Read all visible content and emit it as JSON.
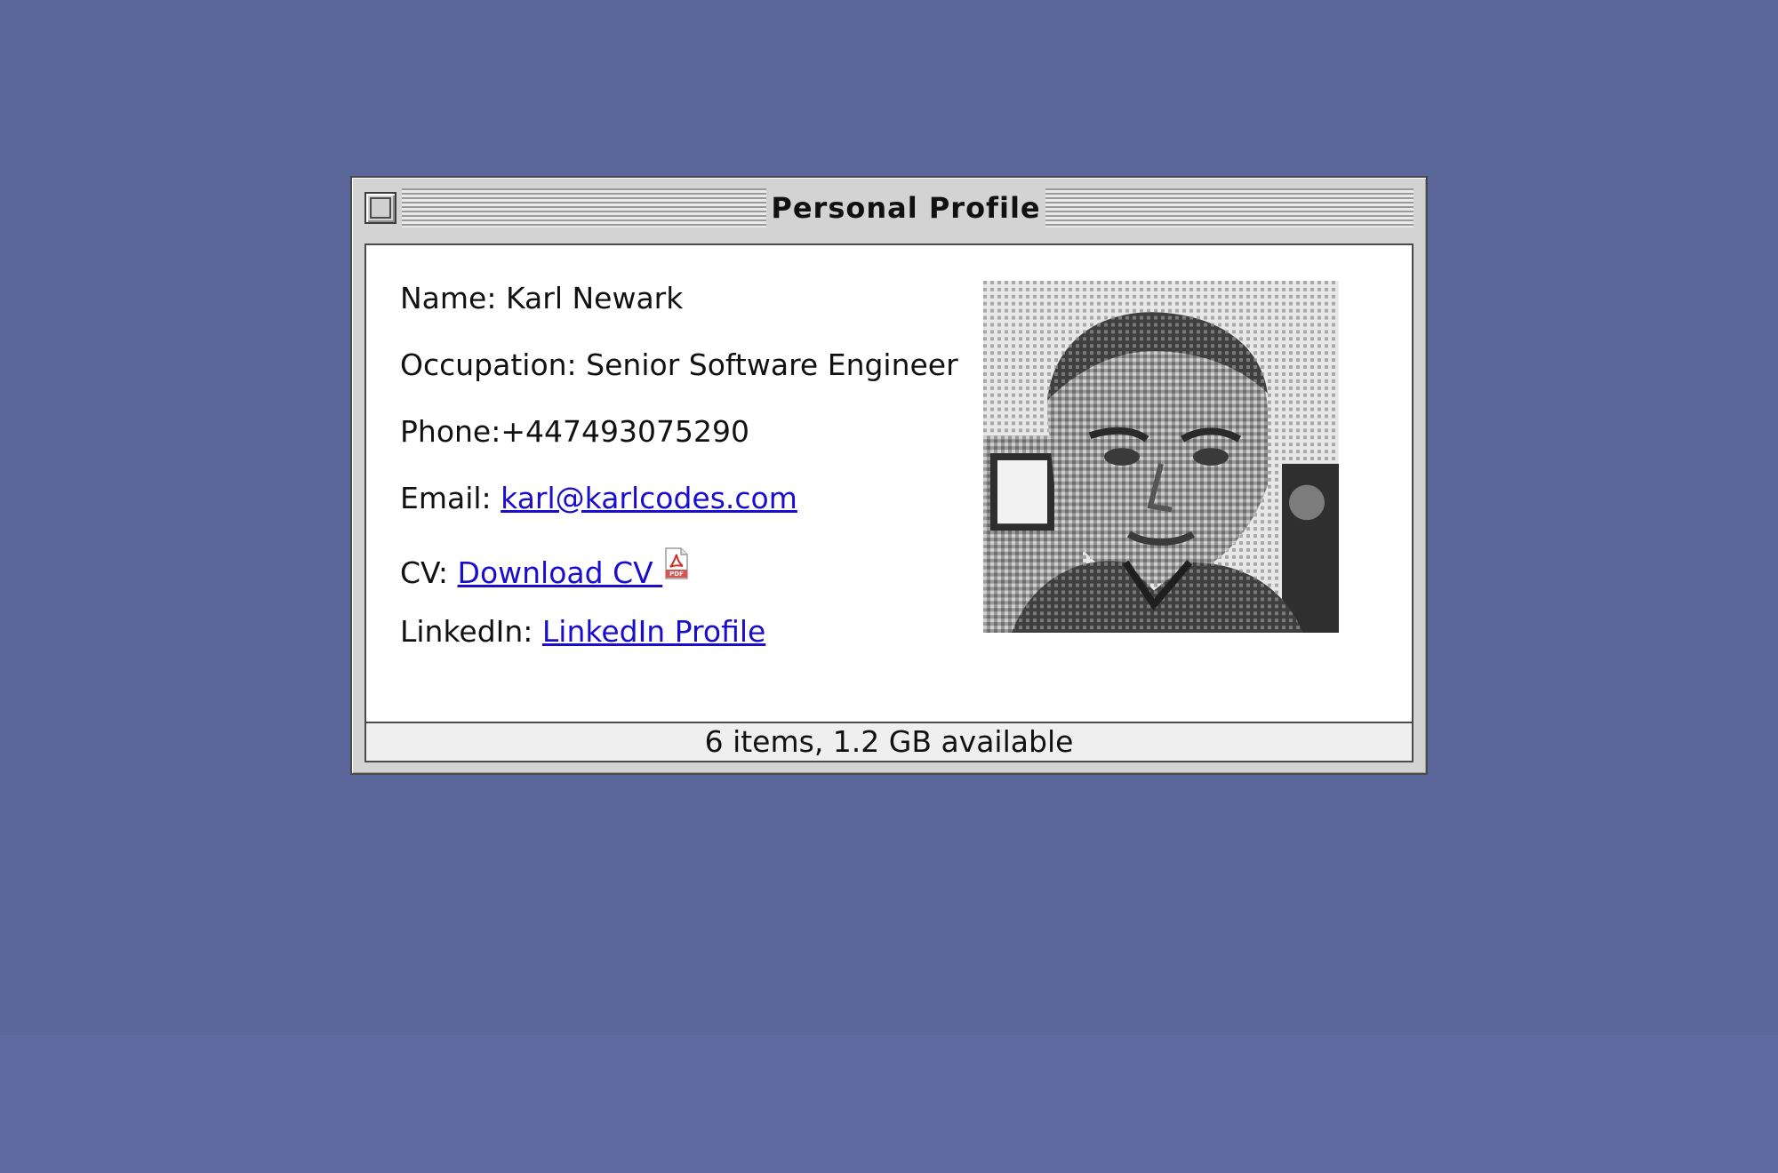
{
  "window": {
    "title": "Personal Profile"
  },
  "profile": {
    "name_label": "Name: ",
    "name_value": "Karl Newark",
    "occupation_label": "Occupation: ",
    "occupation_value": "Senior Software Engineer",
    "phone_label": "Phone:",
    "phone_value": "+447493075290",
    "email_label": "Email: ",
    "email_value": "karl@karlcodes.com",
    "cv_label": "CV: ",
    "cv_link": "Download CV ",
    "linkedin_label": "LinkedIn: ",
    "linkedin_link": "LinkedIn Profile"
  },
  "status": {
    "text": "6 items, 1.2 GB available"
  },
  "icons": {
    "close": "close-box-icon",
    "pdf": "pdf-file-icon",
    "photo": "profile-photo"
  },
  "colors": {
    "desktop": "#5b679b",
    "window": "#d3d3d3",
    "link": "#1a0dcc",
    "content": "#ffffff"
  }
}
